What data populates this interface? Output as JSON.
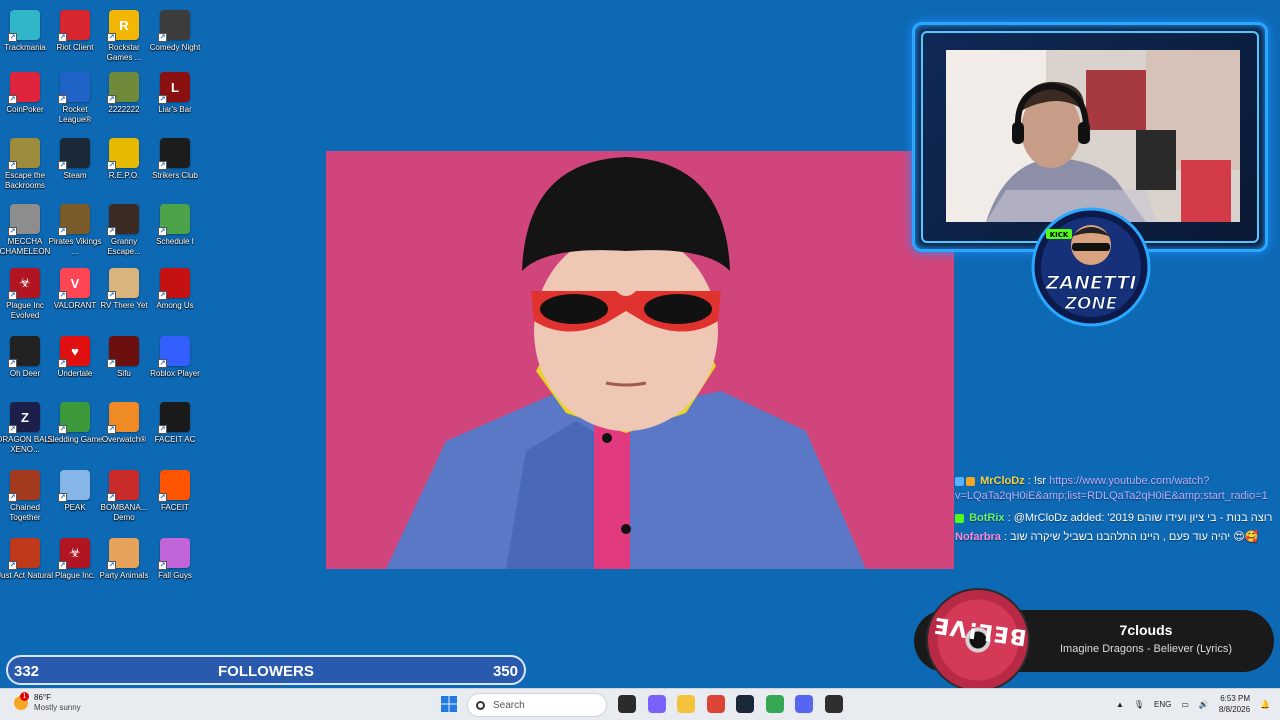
{
  "desktop": {
    "icons": [
      {
        "label": "Trackmania",
        "glyph": "",
        "color": "#2fb7c9"
      },
      {
        "label": "Riot Client",
        "glyph": "",
        "color": "#d7262e"
      },
      {
        "label": "Rockstar Games ...",
        "glyph": "R",
        "color": "#f2b705"
      },
      {
        "label": "Comedy Night",
        "glyph": "",
        "color": "#3c3c3c"
      },
      {
        "label": "CoinPoker",
        "glyph": "",
        "color": "#e0243b"
      },
      {
        "label": "Rocket League®",
        "glyph": "",
        "color": "#1f63c6"
      },
      {
        "label": "2222222",
        "glyph": "",
        "color": "#6e8a3a"
      },
      {
        "label": "Liar's Bar",
        "glyph": "L",
        "color": "#8a1010"
      },
      {
        "label": "Escape the Backrooms",
        "glyph": "",
        "color": "#9c8c3b"
      },
      {
        "label": "Steam",
        "glyph": "",
        "color": "#1b2838"
      },
      {
        "label": "R.E.P.O.",
        "glyph": "",
        "color": "#e6b800"
      },
      {
        "label": "Strikers Club",
        "glyph": "",
        "color": "#1c1c1c"
      },
      {
        "label": "MECCHA CHAMELEON",
        "glyph": "",
        "color": "#8d8d8d"
      },
      {
        "label": "Pirates Vikings ...",
        "glyph": "",
        "color": "#7a5b2a"
      },
      {
        "label": "Granny Escape...",
        "glyph": "",
        "color": "#3a2b24"
      },
      {
        "label": "Schedule I",
        "glyph": "",
        "color": "#4ca34a"
      },
      {
        "label": "Plague Inc Evolved",
        "glyph": "☣",
        "color": "#b01521"
      },
      {
        "label": "VALORANT",
        "glyph": "V",
        "color": "#ff4655"
      },
      {
        "label": "RV There Yet",
        "glyph": "",
        "color": "#d9b47c"
      },
      {
        "label": "Among Us",
        "glyph": "",
        "color": "#c51111"
      },
      {
        "label": "Oh Deer",
        "glyph": "",
        "color": "#222222"
      },
      {
        "label": "Undertale",
        "glyph": "♥",
        "color": "#e01010"
      },
      {
        "label": "Sifu",
        "glyph": "",
        "color": "#6b0f0f"
      },
      {
        "label": "Roblox Player",
        "glyph": "",
        "color": "#335fff"
      },
      {
        "label": "DRAGON BALL XENO...",
        "glyph": "Z",
        "color": "#1b1f4a"
      },
      {
        "label": "Sledding Game",
        "glyph": "",
        "color": "#3c9a3c"
      },
      {
        "label": "Overwatch®",
        "glyph": "",
        "color": "#f08a24"
      },
      {
        "label": "FACEIT AC",
        "glyph": "",
        "color": "#1a1a1a"
      },
      {
        "label": "Chained Together",
        "glyph": "",
        "color": "#a33a1e"
      },
      {
        "label": "PEAK",
        "glyph": "",
        "color": "#86b6e8"
      },
      {
        "label": "BOMBANA... Demo",
        "glyph": "",
        "color": "#c92a2a"
      },
      {
        "label": "FACEIT",
        "glyph": "",
        "color": "#ff5500"
      },
      {
        "label": "Just Act Natural",
        "glyph": "",
        "color": "#c0391a"
      },
      {
        "label": "Plague Inc.",
        "glyph": "☣",
        "color": "#b01521"
      },
      {
        "label": "Party Animals",
        "glyph": "",
        "color": "#e6a15a"
      },
      {
        "label": "Fall Guys",
        "glyph": "",
        "color": "#c064d8"
      }
    ]
  },
  "overlay": {
    "logo_line1": "ZANETTI",
    "logo_line2": "ZONE",
    "logo_tag": "KICK"
  },
  "chat": {
    "messages": [
      {
        "user": "MrCloDz",
        "user_color": "#f5d142",
        "sep": " : ",
        "text": "!sr ",
        "link": "https://www.youtube.com/watch?v=LQaTa2qH0iE&amp;list=RDLQaTa2qH0iE&amp;start_radio=1",
        "badges": [
          "#5bb0ff",
          "#f5a623"
        ]
      },
      {
        "user": "BotRix",
        "user_color": "#6bf06b",
        "sep": " : ",
        "text": "@MrCloDz added: '2019 רוצה בנות - בי ציון ועידו שוהם",
        "link": "",
        "badges": [
          "#53fc18"
        ]
      },
      {
        "user": "Nofarbra",
        "user_color": "#ff8ad8",
        "sep": " : ",
        "text": "יהיה עוד פעם , היינו התלהבנו בשביל שיקרה שוב 😍🥰",
        "link": "",
        "badges": []
      }
    ]
  },
  "now_playing": {
    "channel": "7clouds",
    "track": "Imagine Dragons - Believer (Lyrics)",
    "disc_text": "BEL!VE"
  },
  "followers": {
    "current": "332",
    "label": "FOLLOWERS",
    "goal": "350",
    "progress": 0.0
  },
  "taskbar": {
    "weather_temp": "86°F",
    "weather_desc": "Mostly sunny",
    "weather_alert": "1",
    "search_placeholder": "Search",
    "lang": "ENG",
    "time": "6:53 PM",
    "date": "8/8/2026",
    "pinned": [
      {
        "name": "task-view-icon",
        "color": "#2b2b2b"
      },
      {
        "name": "copilot-icon",
        "color": "#7b61ff"
      },
      {
        "name": "file-explorer-icon",
        "color": "#f3c13a"
      },
      {
        "name": "chrome-icon",
        "color": "#db4437"
      },
      {
        "name": "steam-icon",
        "color": "#1b2838"
      },
      {
        "name": "chrome-profile-icon",
        "color": "#34a853"
      },
      {
        "name": "discord-icon",
        "color": "#5865f2"
      },
      {
        "name": "obs-icon",
        "color": "#302e31"
      }
    ]
  }
}
